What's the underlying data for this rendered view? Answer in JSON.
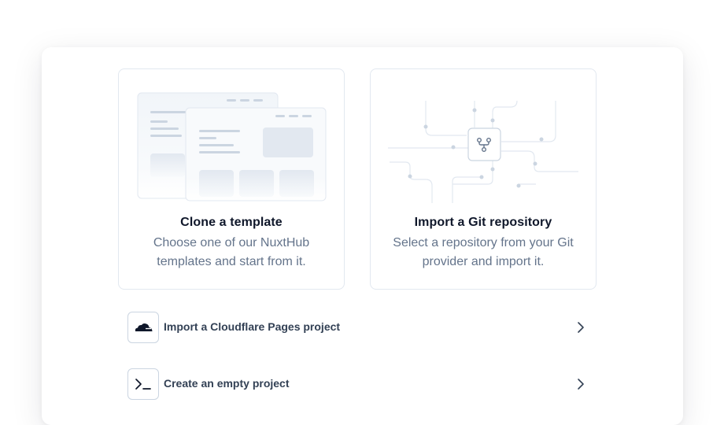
{
  "cards": [
    {
      "title": "Clone a template",
      "description": "Choose one of our NuxtHub templates and start from it.",
      "illustration": "template-wireframe"
    },
    {
      "title": "Import a Git repository",
      "description": "Select a repository from your Git provider and import it.",
      "illustration": "git-branch-circuit"
    }
  ],
  "options": [
    {
      "label": "Import a Cloudflare Pages project",
      "icon": "cloudflare-icon"
    },
    {
      "label": "Create an empty project",
      "icon": "terminal-icon"
    }
  ],
  "colors": {
    "border": "#e2e8f0",
    "title": "#0f172a",
    "muted": "#64748b",
    "label": "#334155",
    "illustration": "#cbd5e1"
  }
}
